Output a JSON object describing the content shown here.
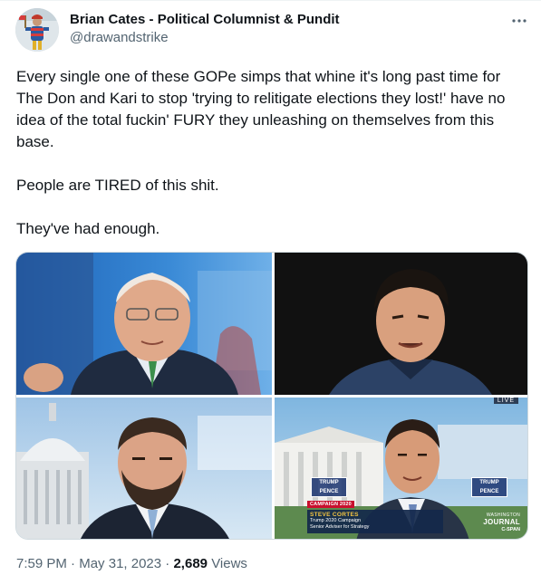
{
  "tweet": {
    "author": {
      "display_name": "Brian Cates - Political Columnist & Pundit",
      "handle": "@drawandstrike",
      "avatar_icon": "profile-photo"
    },
    "more_icon": "more-horizontal-icon",
    "text_paragraphs": [
      "Every single one of these GOPe simps that whine it's long past time for The Don and Kari to stop 'trying to relitigate elections they lost!' have no idea of the total fuckin' FURY they unleashing on themselves from this base.",
      "People are TIRED of this shit.",
      "They've had enough."
    ],
    "media": {
      "bottom_right": {
        "live_badge": "LIVE",
        "sign_left": "TRUMP PENCE",
        "sign_right": "TRUMP PENCE",
        "chyron_tag": "CAMPAIGN 2020",
        "chyron_name": "STEVE CORTES",
        "chyron_line1": "Trump 2020 Campaign",
        "chyron_line2": "Senior Adviser for Strategy",
        "network_small": "WASHINGTON",
        "network_big": "JOURNAL",
        "network_cspan": "C-SPAN"
      }
    },
    "meta": {
      "time": "7:59 PM",
      "separator": "·",
      "date": "May 31, 2023",
      "views_count": "2,689",
      "views_label": "Views"
    }
  }
}
